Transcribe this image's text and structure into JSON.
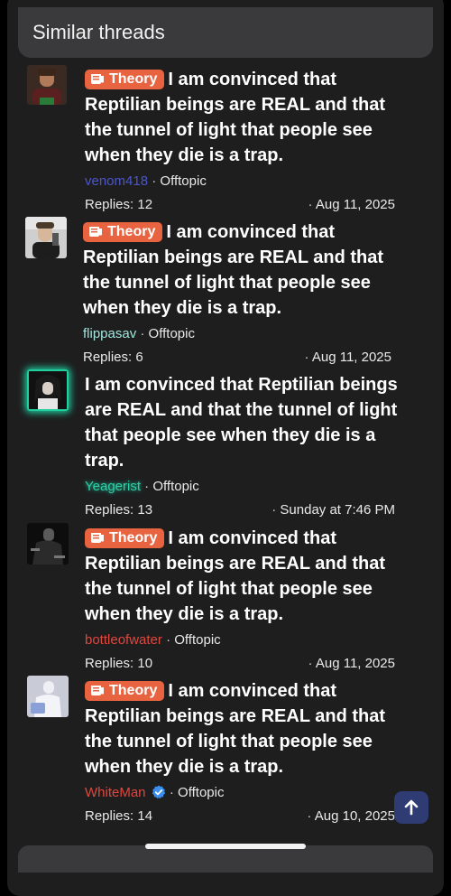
{
  "block": {
    "title": "Similar threads"
  },
  "threads": [
    {
      "prefix": "Theory",
      "title": "I am convinced that Reptilian beings are REAL and that the tunnel of light that people see when they die is a trap.",
      "author": "venom418",
      "author_color": "#4b57c9",
      "forum": "Offtopic",
      "replies": "Replies: 12",
      "date": "Aug 11, 2025"
    },
    {
      "prefix": "Theory",
      "title": "I am convinced that Reptilian beings are REAL and that the tunnel of light that people see when they die is a trap.",
      "author": "flippasav",
      "author_color": "#9fe6dd",
      "forum": "Offtopic",
      "replies": "Replies: 6",
      "date": "Aug 11, 2025"
    },
    {
      "prefix": "",
      "title": "I am convinced that Reptilian beings are REAL and that the tunnel of light that people see when they die is a trap.",
      "author": "Yeagerist",
      "author_color": "#2ccfa8",
      "forum": "Offtopic",
      "replies": "Replies: 13",
      "date": "Sunday at 7:46 PM"
    },
    {
      "prefix": "Theory",
      "title": "I am convinced that Reptilian beings are REAL and that the tunnel of light that people see when they die is a trap.",
      "author": "bottleofwater",
      "author_color": "#e0473d",
      "forum": "Offtopic",
      "replies": "Replies: 10",
      "date": "Aug 11, 2025"
    },
    {
      "prefix": "Theory",
      "title": "I am convinced that Reptilian beings are REAL and that the tunnel of light that people see when they die is a trap.",
      "author": "WhiteMan",
      "author_color": "#e0473d",
      "forum": "Offtopic",
      "replies": "Replies: 14",
      "date": "Aug 10, 2025"
    }
  ],
  "icons": {
    "prefix_icon": "scroll-icon",
    "verified": "verified-badge-icon",
    "scroll_top": "arrow-up-icon"
  },
  "colors": {
    "badge": "#e8633f",
    "verified": "#3a8ff0",
    "scroll_button": "#2f3b73"
  }
}
